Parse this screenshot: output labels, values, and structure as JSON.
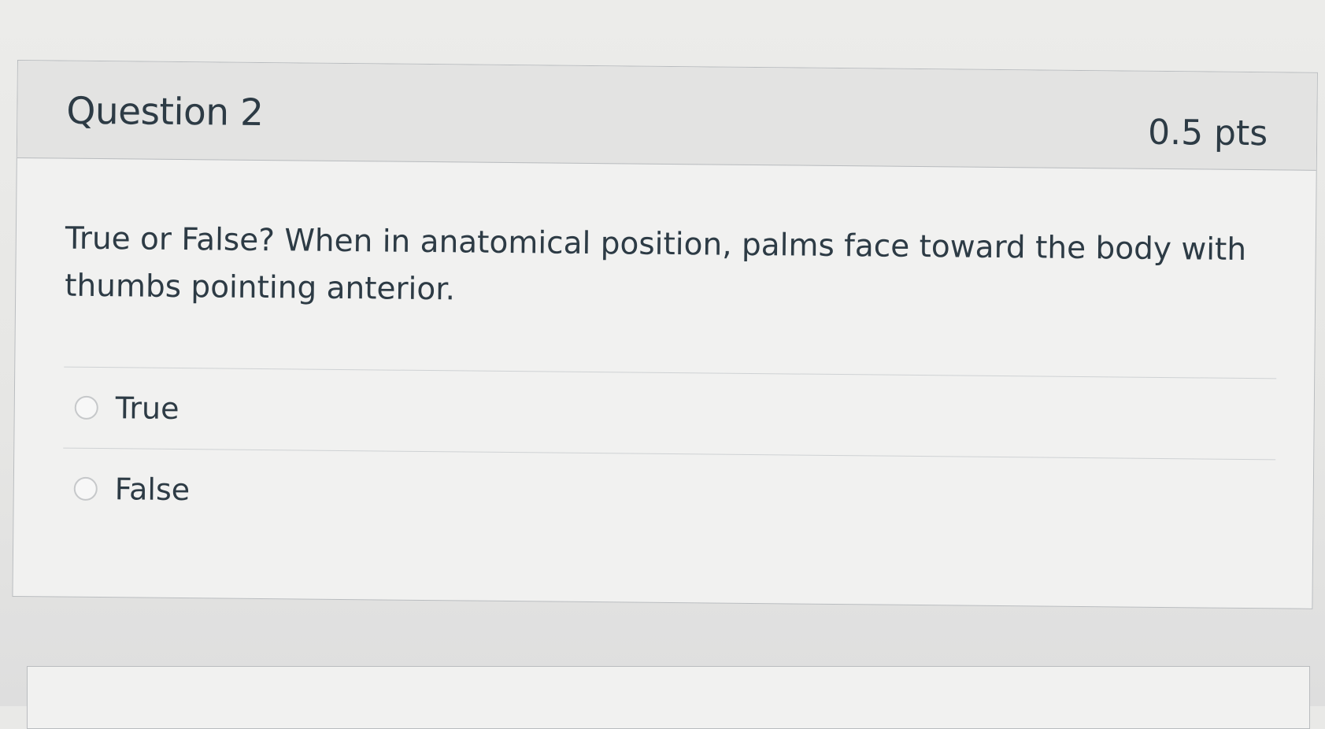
{
  "question": {
    "title": "Question 2",
    "points": "0.5 pts",
    "text": "True or False? When in anatomical position, palms face toward the body with thumbs pointing anterior.",
    "answers": [
      {
        "label": "True",
        "selected": false
      },
      {
        "label": "False",
        "selected": false
      }
    ]
  },
  "colors": {
    "text": "#2d3b45",
    "header_bg": "#e3e3e2",
    "border": "#b9bcbf"
  }
}
